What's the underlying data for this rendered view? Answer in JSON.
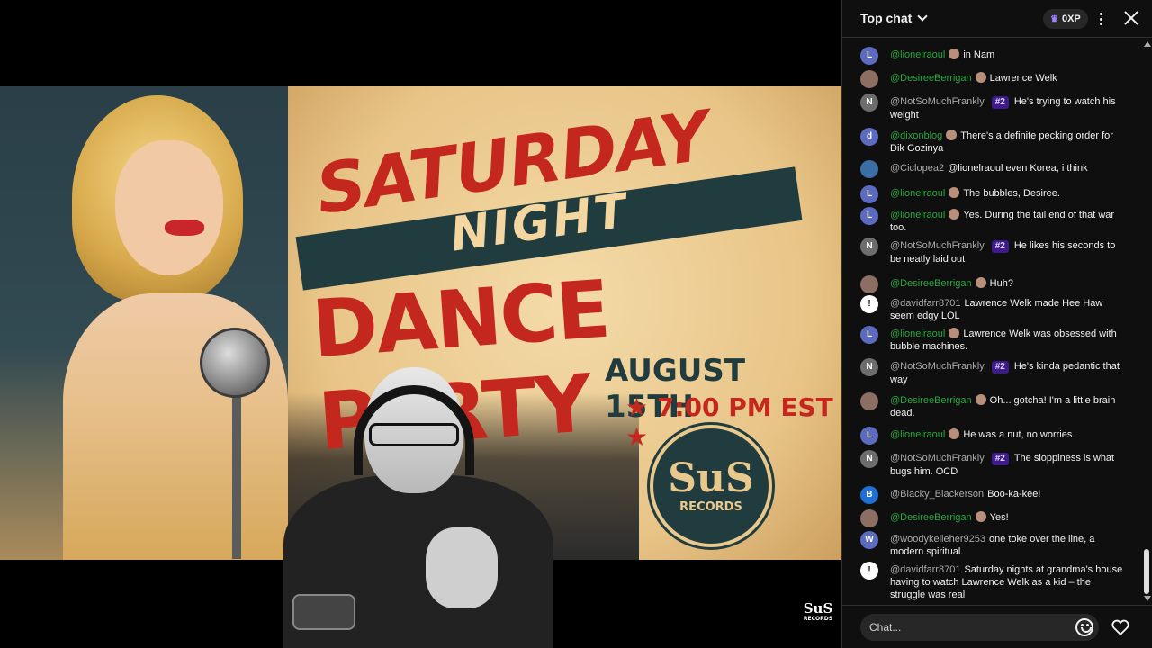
{
  "poster": {
    "title_line1": "SATURDAY",
    "title_line2": "NIGHT",
    "title_line3": "DANCE PARTY",
    "date": "AUGUST 15TH",
    "time": "★ 7:00 PM EST ★",
    "badge_top": "SuS",
    "badge_bottom": "RECORDS"
  },
  "watermark": {
    "top": "SuS",
    "bottom": "RECORDS"
  },
  "header": {
    "title": "Top chat",
    "xp": "0XP"
  },
  "colors": {
    "chat_bg": "#0f0f0f",
    "moderator_name": "#2ba640",
    "member_rank_bg": "#3e1a8a",
    "poster_red": "#c4271e",
    "poster_teal": "#213c3f"
  },
  "messages": [
    {
      "author": "@lionelraoul",
      "text": "in Nam",
      "avatar_letter": "L",
      "avatar_color": "#5c6bc0",
      "style": "green",
      "badge": "mod"
    },
    {
      "author": "@DesireeBerrigan",
      "text": "Lawrence Welk",
      "avatar_letter": "",
      "avatar_color": "#8d6e63",
      "style": "green",
      "badge": "mod"
    },
    {
      "author": "@NotSoMuchFrankly",
      "rank": "#2",
      "text": "He's trying to watch his weight",
      "avatar_letter": "N",
      "avatar_color": "#6d6d6d",
      "style": "grey"
    },
    {
      "author": "@dixonblog",
      "text": "There's a definite pecking order for Dik Gozinya",
      "avatar_letter": "d",
      "avatar_color": "#5c6bc0",
      "style": "green",
      "badge": "mod"
    },
    {
      "author": "@Ciclopea2",
      "text": "@lionelraoul even Korea, i think",
      "avatar_letter": "",
      "avatar_color": "#3a6ea5",
      "style": "grey"
    },
    {
      "author": "@lionelraoul",
      "text": "The bubbles, Desiree.",
      "avatar_letter": "L",
      "avatar_color": "#5c6bc0",
      "style": "green",
      "badge": "mod"
    },
    {
      "author": "@lionelraoul",
      "text": "Yes. During the tail end of that war too.",
      "avatar_letter": "L",
      "avatar_color": "#5c6bc0",
      "style": "green",
      "badge": "mod"
    },
    {
      "author": "@NotSoMuchFrankly",
      "rank": "#2",
      "text": "He likes his seconds to be neatly laid out",
      "avatar_letter": "N",
      "avatar_color": "#6d6d6d",
      "style": "grey"
    },
    {
      "author": "@DesireeBerrigan",
      "text": "Huh?",
      "avatar_letter": "",
      "avatar_color": "#8d6e63",
      "style": "green",
      "badge": "mod"
    },
    {
      "author": "@davidfarr8701",
      "text": "Lawrence Welk made Hee Haw seem edgy LOL",
      "avatar_letter": "!",
      "avatar_color": "#ffffff",
      "style": "grey"
    },
    {
      "author": "@lionelraoul",
      "text": "Lawrence Welk was obsessed with bubble machines.",
      "avatar_letter": "L",
      "avatar_color": "#5c6bc0",
      "style": "green",
      "badge": "mod"
    },
    {
      "author": "@NotSoMuchFrankly",
      "rank": "#2",
      "text": "He's kinda pedantic that way",
      "avatar_letter": "N",
      "avatar_color": "#6d6d6d",
      "style": "grey"
    },
    {
      "author": "@DesireeBerrigan",
      "text": "Oh... gotcha! I'm a little brain dead.",
      "avatar_letter": "",
      "avatar_color": "#8d6e63",
      "style": "green",
      "badge": "mod"
    },
    {
      "author": "@lionelraoul",
      "text": "He was a nut, no worries.",
      "avatar_letter": "L",
      "avatar_color": "#5c6bc0",
      "style": "green",
      "badge": "mod"
    },
    {
      "author": "@NotSoMuchFrankly",
      "rank": "#2",
      "text": "The sloppiness is what bugs him. OCD",
      "avatar_letter": "N",
      "avatar_color": "#6d6d6d",
      "style": "grey"
    },
    {
      "author": "@Blacky_Blackerson",
      "text": "Boo-ka-kee!",
      "avatar_letter": "B",
      "avatar_color": "#1e6fd6",
      "style": "grey"
    },
    {
      "author": "@DesireeBerrigan",
      "text": "Yes!",
      "avatar_letter": "",
      "avatar_color": "#8d6e63",
      "style": "green",
      "badge": "mod"
    },
    {
      "author": "@woodykelleher9253",
      "text": "one toke over the line, a modern spiritual.",
      "avatar_letter": "W",
      "avatar_color": "#5c6bc0",
      "style": "grey"
    },
    {
      "author": "@davidfarr8701",
      "text": "Saturday nights at grandma's house having to watch Lawrence Welk as a kid – the struggle was real",
      "avatar_letter": "!",
      "avatar_color": "#ffffff",
      "style": "grey"
    }
  ],
  "input": {
    "placeholder": "Chat..."
  }
}
